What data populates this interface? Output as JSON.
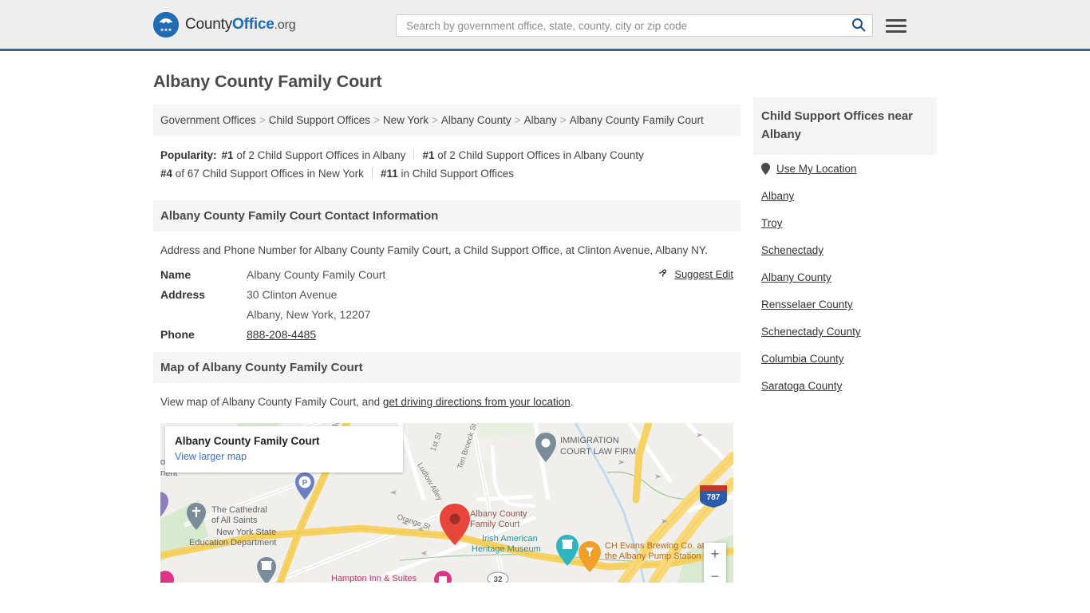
{
  "header": {
    "logo": {
      "icon": "eagle-shield-logo-icon",
      "text_county": "County",
      "text_office": "Office",
      "text_org": ".org"
    },
    "search": {
      "placeholder": "Search by government office, state, county, city or zip code",
      "value": "",
      "icon": "search-icon"
    },
    "menu_icon": "hamburger-menu-icon",
    "accent_color": "#36699f",
    "background_color": "#eeeeee"
  },
  "page_title": "Albany County Family Court",
  "breadcrumb": {
    "separator": ">",
    "items": [
      "Government Offices",
      "Child Support Offices",
      "New York",
      "Albany County",
      "Albany",
      "Albany County Family Court"
    ]
  },
  "popularity": {
    "label": "Popularity:",
    "items": [
      {
        "rank": "#1",
        "text": "of 2 Child Support Offices in Albany"
      },
      {
        "rank": "#1",
        "text": "of 2 Child Support Offices in Albany County"
      },
      {
        "rank": "#4",
        "text": "of 67 Child Support Offices in New York"
      },
      {
        "rank": "#11",
        "text": "in Child Support Offices"
      }
    ]
  },
  "contact": {
    "heading": "Albany County Family Court Contact Information",
    "description": "Address and Phone Number for Albany County Family Court, a Child Support Office, at Clinton Avenue, Albany NY.",
    "rows": [
      {
        "key": "Name",
        "value": "Albany County Family Court",
        "is_link": false
      },
      {
        "key": "Address",
        "value": "30 Clinton Avenue",
        "is_link": false
      },
      {
        "key": "",
        "value": "Albany, New York, 12207",
        "is_link": false
      },
      {
        "key": "Phone",
        "value": "888-208-4485",
        "is_link": true
      }
    ],
    "suggest_edit": {
      "label": "Suggest Edit",
      "icon": "suggest-edit-icon"
    }
  },
  "map_section": {
    "heading": "Map of Albany County Family Court",
    "description_prefix": "View map of Albany County Family Court, and ",
    "description_link": "get driving directions from your location",
    "description_suffix": ".",
    "card": {
      "title": "Albany County Family Court",
      "link": "View larger map"
    },
    "zoom_in": "+",
    "zoom_out": "−",
    "labels": {
      "court_marker": "Albany County Family Court",
      "immigration": "IMMIGRATION COURT LAW FIRM",
      "cathedral": "The Cathedral of All Saints",
      "nysed": "New York State Education Department",
      "irish_museum": "Irish American Heritage Museum",
      "brewing": "CH Evans Brewing Co. at the Albany Pump Station",
      "hampton": "Hampton Inn & Suites",
      "parking": "P",
      "highway_shield": "787",
      "route_shield": "32",
      "streets": [
        "1st St",
        "Ludlow Alley",
        "Ten Broeck St",
        "Orange St"
      ]
    }
  },
  "sidebar": {
    "heading": "Child Support Offices near Albany",
    "use_my_location": {
      "label": "Use My Location",
      "icon": "map-pin-icon"
    },
    "links": [
      "Albany",
      "Troy",
      "Schenectady",
      "Albany County",
      "Rensselaer County",
      "Schenectady County",
      "Columbia County",
      "Saratoga County"
    ]
  }
}
